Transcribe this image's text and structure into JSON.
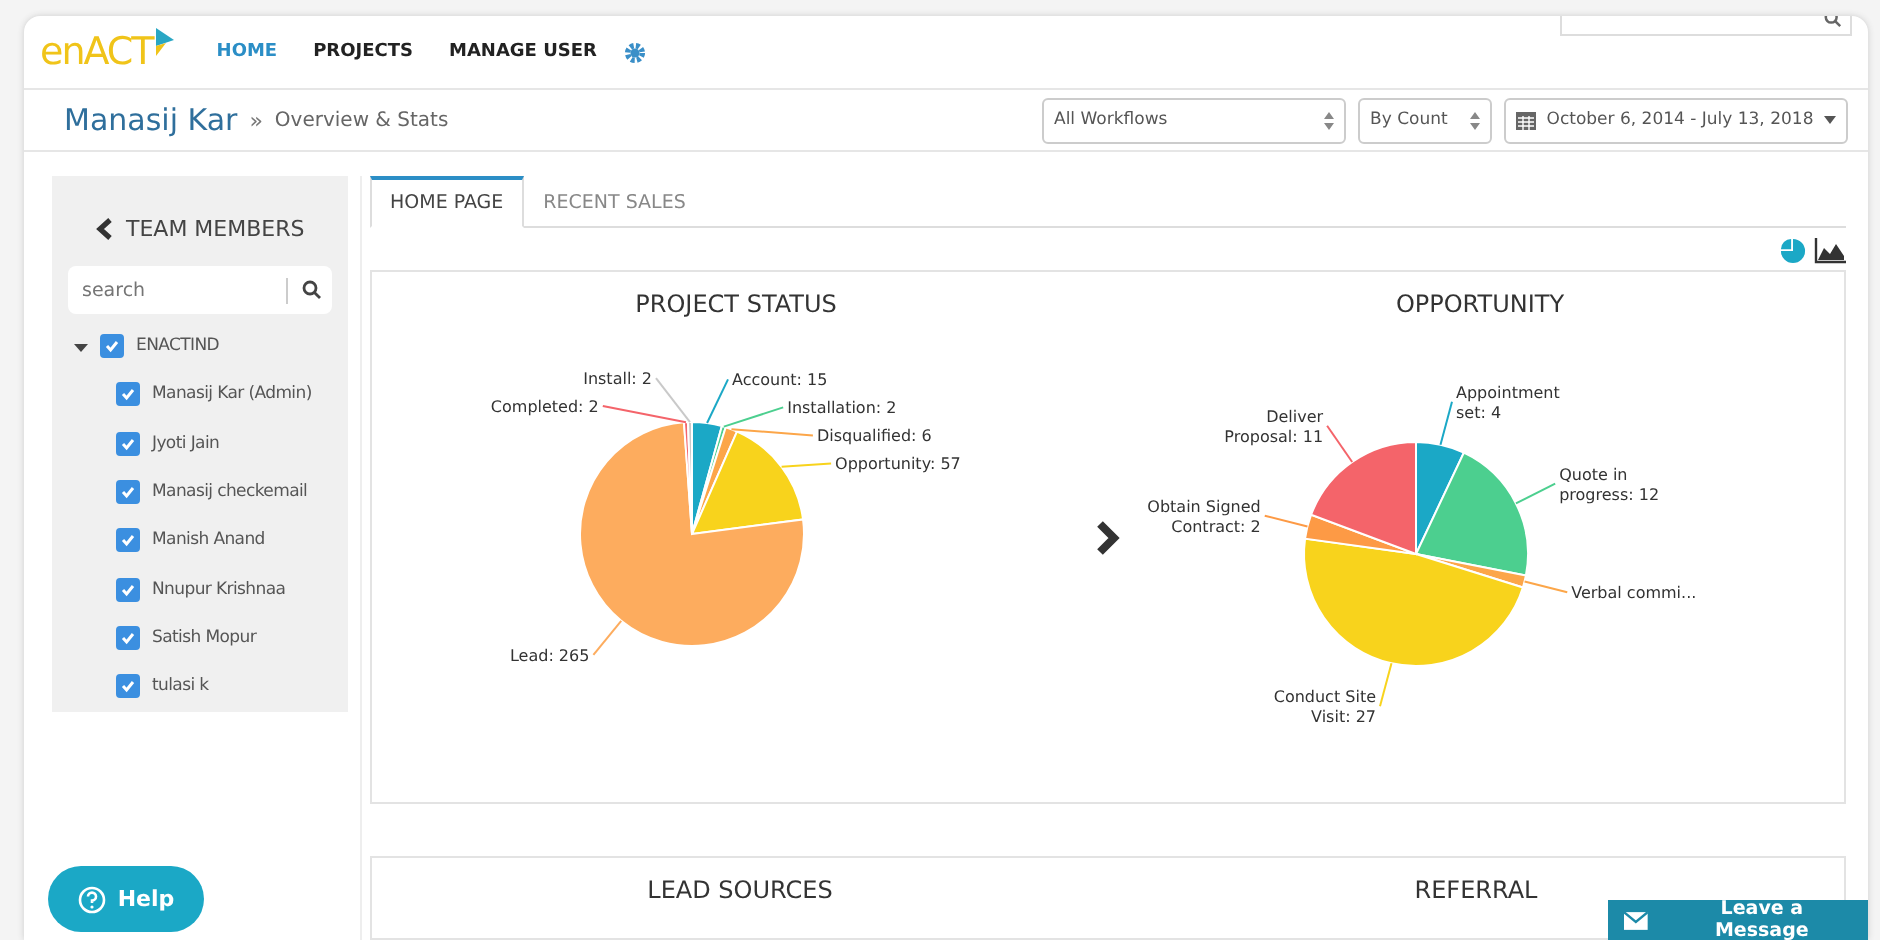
{
  "logo": "enACT",
  "nav": [
    {
      "label": "HOME",
      "selected": true
    },
    {
      "label": "PROJECTS",
      "selected": false
    },
    {
      "label": "MANAGE USER",
      "selected": false
    }
  ],
  "breadcrumb": {
    "user": "Manasij Kar",
    "separator": "»",
    "page": "Overview & Stats"
  },
  "filters": {
    "workflow": "All Workflows",
    "measure": "By Count",
    "date_range": "October 6, 2014 - July 13, 2018"
  },
  "sidebar": {
    "title": "TEAM MEMBERS",
    "search": {
      "placeholder": "search"
    },
    "tree": [
      {
        "label": "ENACTIND",
        "checked": true,
        "expanded": true,
        "children": [
          {
            "label": "Manasij Kar (Admin)",
            "checked": true
          },
          {
            "label": "Jyoti Jain",
            "checked": true
          },
          {
            "label": "Manasij checkemail",
            "checked": true
          },
          {
            "label": "Manish Anand",
            "checked": true
          },
          {
            "label": "Nnupur Krishnaa",
            "checked": true
          },
          {
            "label": "Satish Mopur",
            "checked": true
          },
          {
            "label": "tulasi k",
            "checked": true
          }
        ]
      }
    ]
  },
  "tabs": [
    {
      "label": "HOME PAGE",
      "selected": true
    },
    {
      "label": "RECENT SALES",
      "selected": false
    }
  ],
  "charts": [
    {
      "chart_data": {
        "type": "pie",
        "title": "PROJECT STATUS",
        "values": [
          15,
          2,
          6,
          57,
          265,
          2,
          2
        ],
        "colors": [
          "#1ba8c6",
          "#4ccf8f",
          "#fca649",
          "#f8d31c",
          "#fdac5e",
          "#f4646a",
          "#c9c9c9"
        ],
        "value_labels": [
          "Account: 15",
          "Installation: 2",
          "Disqualified: 6",
          "Opportunity: 57",
          "Lead: 265",
          "Completed: 2",
          "Install: 2"
        ]
      }
    },
    {
      "chart_data": {
        "type": "pie",
        "title": "OPPORTUNITY",
        "values": [
          4,
          12,
          1,
          27,
          2,
          11
        ],
        "colors": [
          "#1ba8c6",
          "#4ccf8f",
          "#fca649",
          "#f8d31c",
          "#fd9a45",
          "#f4646a"
        ],
        "value_labels": [
          "Appointment set: 4",
          "Quote in progress: 12",
          "Verbal commi...",
          "Conduct Site Visit: 27",
          "Obtain Signed Contract: 2",
          "Deliver Proposal: 11"
        ]
      }
    }
  ],
  "lower_panels": [
    "LEAD SOURCES",
    "REFERRAL"
  ],
  "help": "Help",
  "message": "Leave a Message"
}
